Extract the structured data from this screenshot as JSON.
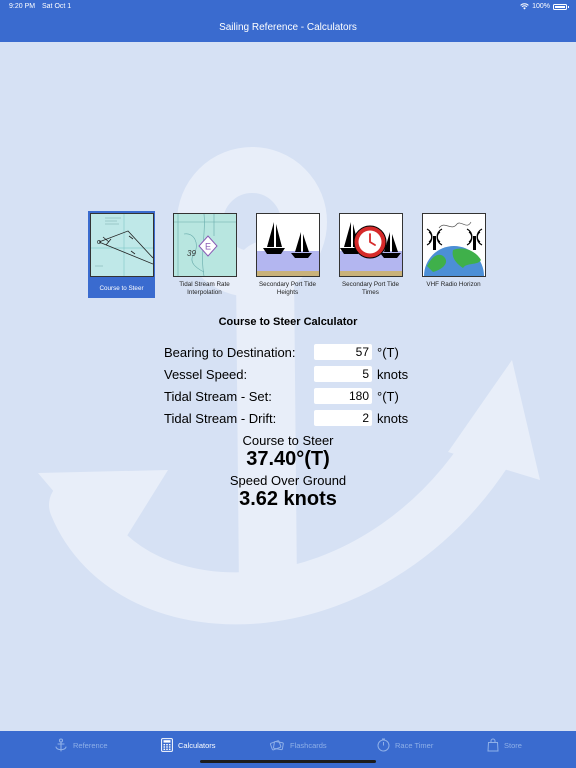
{
  "status_bar": {
    "time": "9:20 PM",
    "date": "Sat Oct 1",
    "battery": "100%"
  },
  "nav": {
    "title": "Sailing Reference - Calculators"
  },
  "calculators": [
    {
      "label": "Course to Steer",
      "icon": "course-chart-icon",
      "selected": true
    },
    {
      "label": "Tidal Stream Rate Interpolation",
      "icon": "tidal-diamond-icon",
      "selected": false
    },
    {
      "label": "Secondary Port Tide Heights",
      "icon": "sailboats-tide-icon",
      "selected": false
    },
    {
      "label": "Secondary Port Tide Times",
      "icon": "sailboats-clock-icon",
      "selected": false
    },
    {
      "label": "VHF Radio Horizon",
      "icon": "radio-globe-icon",
      "selected": false
    }
  ],
  "thumb_text": {
    "tidal_depth": "39",
    "tidal_diamond": "E"
  },
  "calculator": {
    "title": "Course to Steer Calculator",
    "fields": [
      {
        "label": "Bearing to Destination:",
        "value": "57",
        "unit": "°(T)"
      },
      {
        "label": "Vessel Speed:",
        "value": "5",
        "unit": "knots"
      },
      {
        "label": "Tidal Stream - Set:",
        "value": "180",
        "unit": "°(T)"
      },
      {
        "label": "Tidal Stream - Drift:",
        "value": "2",
        "unit": "knots"
      }
    ],
    "results": [
      {
        "label": "Course to Steer",
        "value": "37.40°(T)"
      },
      {
        "label": "Speed Over Ground",
        "value": "3.62 knots"
      }
    ]
  },
  "tabs": [
    {
      "label": "Reference",
      "icon": "anchor-icon",
      "active": false
    },
    {
      "label": "Calculators",
      "icon": "calculator-icon",
      "active": true
    },
    {
      "label": "Flashcards",
      "icon": "flashcards-icon",
      "active": false
    },
    {
      "label": "Race Timer",
      "icon": "stopwatch-icon",
      "active": false
    },
    {
      "label": "Store",
      "icon": "shopping-bag-icon",
      "active": false
    }
  ],
  "colors": {
    "accent": "#3a6bcf",
    "background": "#d6e1f4",
    "watermark": "#e8eef9"
  }
}
